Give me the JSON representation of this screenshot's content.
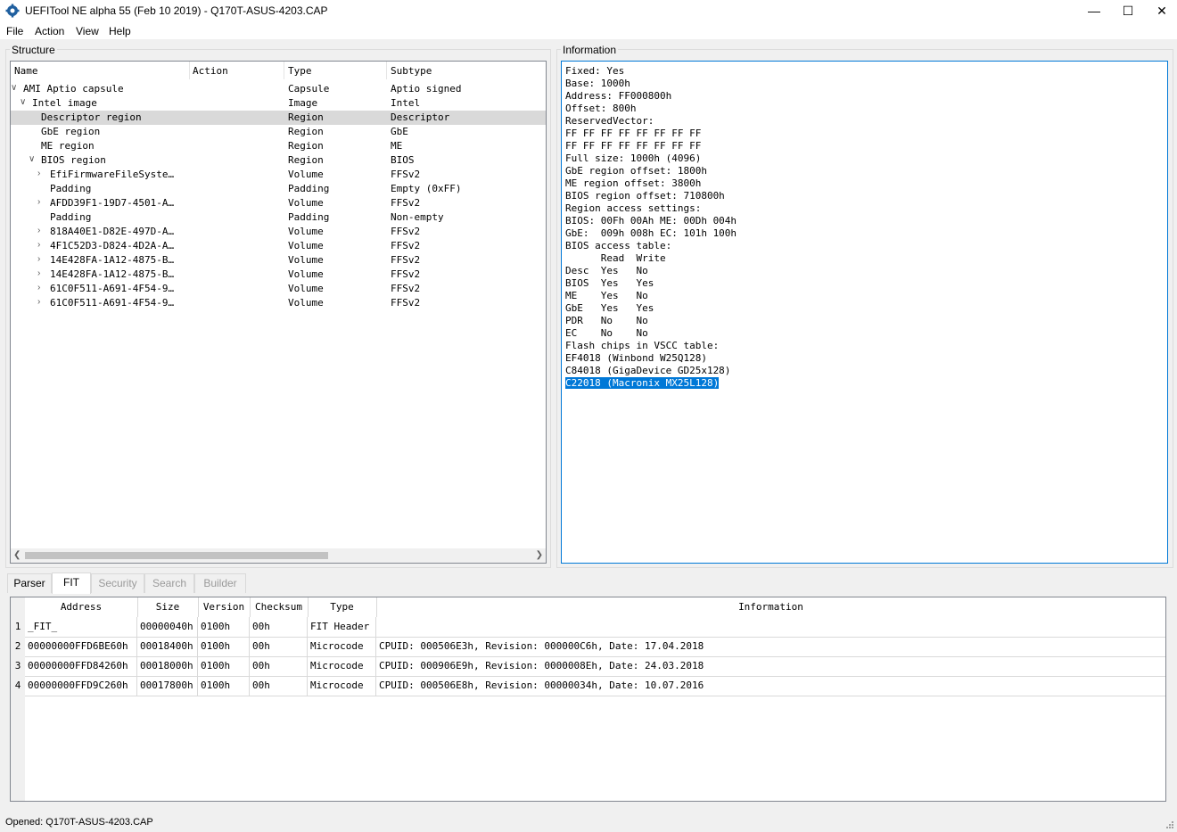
{
  "window": {
    "title": "UEFITool NE alpha 55 (Feb 10 2019) - Q170T-ASUS-4203.CAP",
    "minimize": "—",
    "maximize": "☐",
    "close": "✕"
  },
  "menu": [
    "File",
    "Action",
    "View",
    "Help"
  ],
  "structure": {
    "title": "Structure",
    "columns": [
      "Name",
      "Action",
      "Type",
      "Subtype"
    ],
    "rows": [
      {
        "name": "AMI Aptio capsule",
        "action": "",
        "type": "Capsule",
        "subtype": "Aptio signed",
        "expander": "expanded"
      },
      {
        "name": "Intel image",
        "action": "",
        "type": "Image",
        "subtype": "Intel",
        "expander": "expanded"
      },
      {
        "name": "Descriptor region",
        "action": "",
        "type": "Region",
        "subtype": "Descriptor",
        "expander": "none",
        "selected": true
      },
      {
        "name": "GbE region",
        "action": "",
        "type": "Region",
        "subtype": "GbE",
        "expander": "none"
      },
      {
        "name": "ME region",
        "action": "",
        "type": "Region",
        "subtype": "ME",
        "expander": "none"
      },
      {
        "name": "BIOS region",
        "action": "",
        "type": "Region",
        "subtype": "BIOS",
        "expander": "expanded"
      },
      {
        "name": "EfiFirmwareFileSyste…",
        "action": "",
        "type": "Volume",
        "subtype": "FFSv2",
        "expander": "collapsed"
      },
      {
        "name": "Padding",
        "action": "",
        "type": "Padding",
        "subtype": "Empty (0xFF)",
        "expander": "none"
      },
      {
        "name": "AFDD39F1-19D7-4501-A…",
        "action": "",
        "type": "Volume",
        "subtype": "FFSv2",
        "expander": "collapsed"
      },
      {
        "name": "Padding",
        "action": "",
        "type": "Padding",
        "subtype": "Non-empty",
        "expander": "none"
      },
      {
        "name": "818A40E1-D82E-497D-A…",
        "action": "",
        "type": "Volume",
        "subtype": "FFSv2",
        "expander": "collapsed"
      },
      {
        "name": "4F1C52D3-D824-4D2A-A…",
        "action": "",
        "type": "Volume",
        "subtype": "FFSv2",
        "expander": "collapsed"
      },
      {
        "name": "14E428FA-1A12-4875-B…",
        "action": "",
        "type": "Volume",
        "subtype": "FFSv2",
        "expander": "collapsed"
      },
      {
        "name": "14E428FA-1A12-4875-B…",
        "action": "",
        "type": "Volume",
        "subtype": "FFSv2",
        "expander": "collapsed"
      },
      {
        "name": "61C0F511-A691-4F54-9…",
        "action": "",
        "type": "Volume",
        "subtype": "FFSv2",
        "expander": "collapsed"
      },
      {
        "name": "61C0F511-A691-4F54-9…",
        "action": "",
        "type": "Volume",
        "subtype": "FFSv2",
        "expander": "collapsed"
      }
    ]
  },
  "information": {
    "title": "Information",
    "lines": [
      "Fixed: Yes",
      "Base: 1000h",
      "Address: FF000800h",
      "Offset: 800h",
      "ReservedVector:",
      "FF FF FF FF FF FF FF FF",
      "FF FF FF FF FF FF FF FF",
      "Full size: 1000h (4096)",
      "GbE region offset: 1800h",
      "ME region offset: 3800h",
      "BIOS region offset: 710800h",
      "Region access settings:",
      "BIOS: 00Fh 00Ah ME: 00Dh 004h",
      "GbE:  009h 008h EC: 101h 100h",
      "BIOS access table:",
      "      Read  Write",
      "Desc  Yes   No",
      "BIOS  Yes   Yes",
      "ME    Yes   No",
      "GbE   Yes   Yes",
      "PDR   No    No",
      "EC    No    No",
      "Flash chips in VSCC table:",
      "EF4018 (Winbond W25Q128)",
      "C84018 (GigaDevice GD25x128)"
    ],
    "selected_line": "C22018 (Macronix MX25L128)"
  },
  "tabs": [
    {
      "label": "Parser",
      "state": "normal"
    },
    {
      "label": "FIT",
      "state": "active"
    },
    {
      "label": "Security",
      "state": "disabled"
    },
    {
      "label": "Search",
      "state": "disabled"
    },
    {
      "label": "Builder",
      "state": "disabled"
    }
  ],
  "fit": {
    "columns": [
      "Address",
      "Size",
      "Version",
      "Checksum",
      "Type",
      "Information"
    ],
    "rows": [
      {
        "num": "1",
        "address": "_FIT_",
        "size": "00000040h",
        "version": "0100h",
        "checksum": "00h",
        "type": "FIT Header",
        "info": ""
      },
      {
        "num": "2",
        "address": "00000000FFD6BE60h",
        "size": "00018400h",
        "version": "0100h",
        "checksum": "00h",
        "type": "Microcode",
        "info": "CPUID: 000506E3h, Revision: 000000C6h, Date: 17.04.2018"
      },
      {
        "num": "3",
        "address": "00000000FFD84260h",
        "size": "00018000h",
        "version": "0100h",
        "checksum": "00h",
        "type": "Microcode",
        "info": "CPUID: 000906E9h, Revision: 0000008Eh, Date: 24.03.2018"
      },
      {
        "num": "4",
        "address": "00000000FFD9C260h",
        "size": "00017800h",
        "version": "0100h",
        "checksum": "00h",
        "type": "Microcode",
        "info": "CPUID: 000506E8h, Revision: 00000034h, Date: 10.07.2016"
      }
    ]
  },
  "status": "Opened: Q170T-ASUS-4203.CAP",
  "colors": {
    "selection": "#0078d7",
    "tree_selected": "#d9d9d9"
  }
}
